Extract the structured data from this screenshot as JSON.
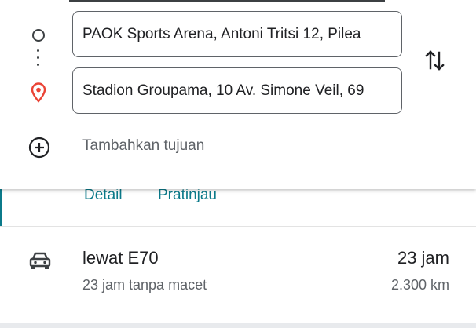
{
  "directions": {
    "origin": {
      "value": "PAOK Sports Arena, Antoni Tritsi 12, Pilea"
    },
    "destination": {
      "value": "Stadion Groupama, 10 Av. Simone Veil, 69"
    },
    "add_destination_label": "Tambahkan tujuan",
    "icons": {
      "origin": "origin-circle-icon",
      "connector": "vertical-dots-icon",
      "destination": "location-pin-icon",
      "swap": "swap-vertical-icon",
      "add": "add-circle-icon"
    }
  },
  "route_actions": {
    "detail_label": "Detail",
    "preview_label": "Pratinjau"
  },
  "route": {
    "icon": "car-icon",
    "name": "lewat E70",
    "duration": "23 jam",
    "traffic_note": "23 jam tanpa macet",
    "distance": "2.300 km"
  },
  "colors": {
    "accent": "#0b7a8a",
    "pin": "#ea4335",
    "text_primary": "#202124",
    "text_secondary": "#5f6368"
  }
}
